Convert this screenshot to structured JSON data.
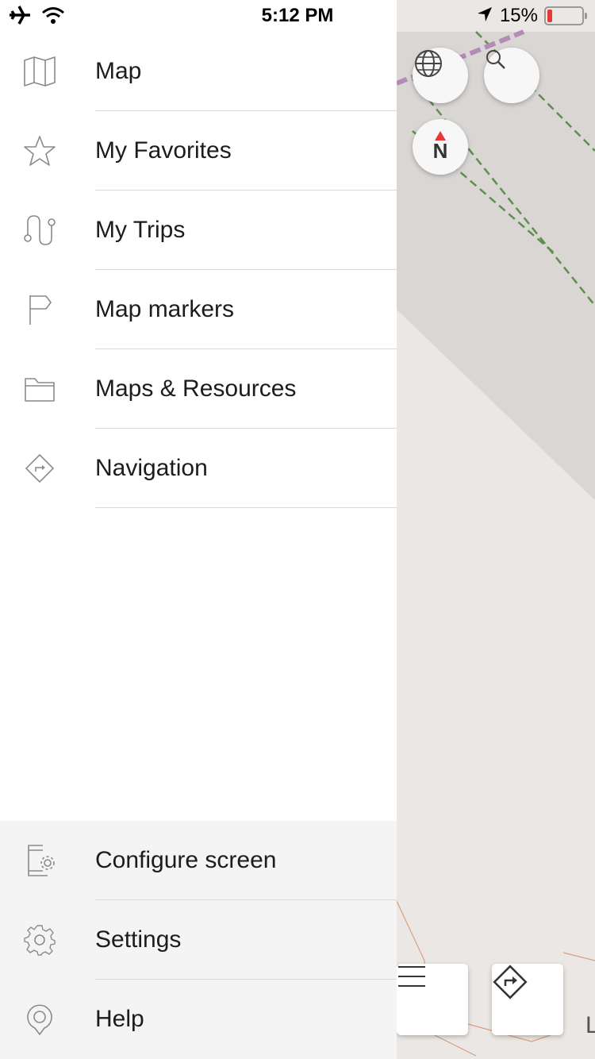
{
  "status_bar": {
    "time": "5:12 PM",
    "battery_percent": "15%",
    "battery_color": "#e53935"
  },
  "drawer": {
    "items": [
      {
        "label": "Map",
        "icon": "map-icon"
      },
      {
        "label": "My Favorites",
        "icon": "star-icon"
      },
      {
        "label": "My Trips",
        "icon": "route-icon"
      },
      {
        "label": "Map markers",
        "icon": "flag-icon"
      },
      {
        "label": "Maps & Resources",
        "icon": "folder-icon"
      },
      {
        "label": "Navigation",
        "icon": "navigation-icon"
      }
    ],
    "bottom_items": [
      {
        "label": "Configure screen",
        "icon": "configure-screen-icon"
      },
      {
        "label": "Settings",
        "icon": "gear-icon"
      },
      {
        "label": "Help",
        "icon": "help-icon"
      }
    ]
  },
  "map": {
    "buttons": [
      "globe-icon",
      "search-icon",
      "compass-icon",
      "menu-icon",
      "directions-icon"
    ],
    "compass_letter": "N",
    "edge_letter": "L"
  }
}
